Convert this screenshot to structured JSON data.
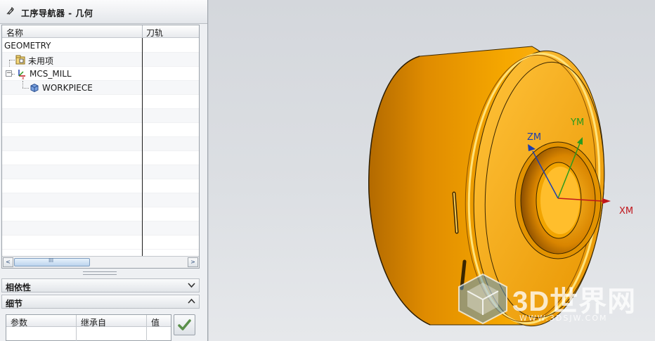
{
  "navigator": {
    "title": "工序导航器 - 几何",
    "columns": {
      "name": "名称",
      "toolpath": "刀轨"
    },
    "items": [
      {
        "label": "GEOMETRY"
      },
      {
        "label": "未用项"
      },
      {
        "label": "MCS_MILL"
      },
      {
        "label": "WORKPIECE"
      }
    ],
    "scroll_left": "<",
    "scroll_right": ">",
    "scroll_thumb": "III"
  },
  "sections": {
    "dependencies": "相依性",
    "details": "细节"
  },
  "details_table": {
    "columns": [
      "参数",
      "继承自",
      "值"
    ]
  },
  "viewport": {
    "axes": {
      "x": "XM",
      "y": "YM",
      "z": "ZM"
    },
    "axis_colors": {
      "x": "#c0171c",
      "y": "#2a9a1e",
      "z": "#1d3fb0"
    },
    "part_color": "#f5a300"
  },
  "watermark": {
    "brand": "3D世界网",
    "url": "WWW.3DSJW.COM"
  }
}
